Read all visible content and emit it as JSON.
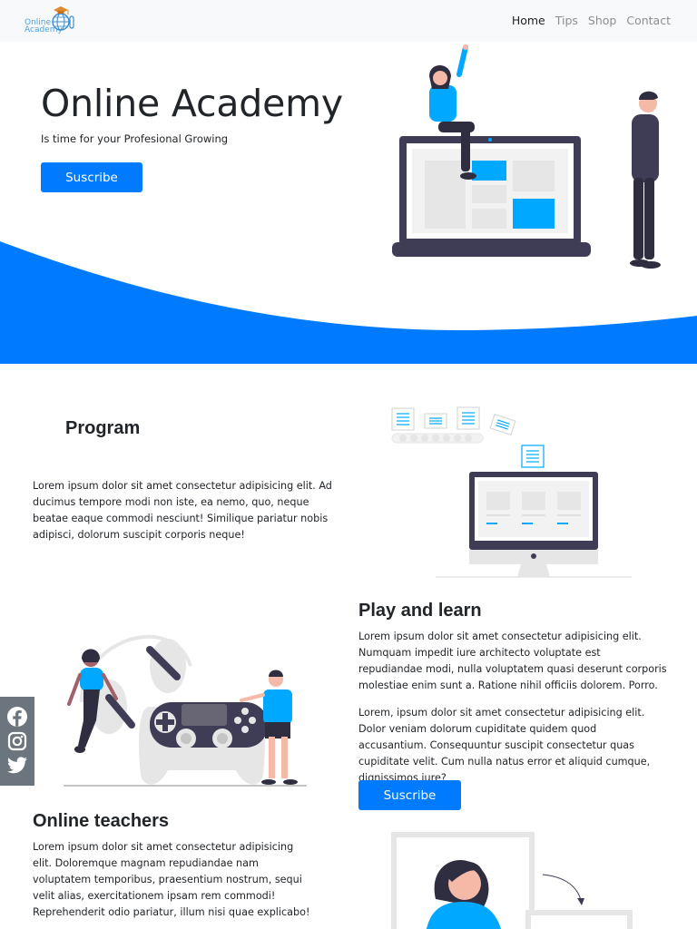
{
  "navbar": {
    "brand": {
      "line1": "Online",
      "line2": "Academy"
    },
    "links": [
      {
        "label": "Home",
        "active": true
      },
      {
        "label": "Tips",
        "active": false
      },
      {
        "label": "Shop",
        "active": false
      },
      {
        "label": "Contact",
        "active": false
      }
    ]
  },
  "hero": {
    "title": "Online Academy",
    "subtitle": "Is time for your Profesional Growing",
    "button_label": "Suscribe"
  },
  "program": {
    "title": "Program",
    "text": "Lorem ipsum dolor sit amet consectetur adipisicing elit. Ad ducimus tempore modi non iste, ea nemo, quo, neque beatae eaque commodi nesciunt! Similique pariatur nobis adipisci, dolorum suscipit corporis neque!"
  },
  "play": {
    "title": "Play and learn",
    "paragraph1": "Lorem ipsum dolor sit amet consectetur adipisicing elit. Numquam impedit iure architecto voluptate est repudiandae modi, nulla voluptatem quasi deserunt corporis molestiae enim sunt a. Ratione nihil officiis dolorem. Porro.",
    "paragraph2": "Lorem, ipsum dolor sit amet consectetur adipisicing elit. Dolor veniam dolorum cupiditate quidem quod accusantium. Consequuntur suscipit consectetur quas cupiditate velit. Cum nulla natus error et aliquid cumque, dignissimos iure?",
    "button_label": "Suscribe"
  },
  "teachers": {
    "title": "Online teachers",
    "text": "Lorem ipsum dolor sit amet consectetur adipisicing elit. Doloremque magnam repudiandae nam voluptatem temporibus, praesentium nostrum, sequi velit alias, exercitationem ipsam rem commodi! Reprehenderit odio pariatur, illum nisi quae explicabo!"
  },
  "social": {
    "icons": [
      "facebook-icon",
      "instagram-icon",
      "twitter-icon"
    ]
  },
  "colors": {
    "accent": "#007bff",
    "illustration_blue": "#00a8ff",
    "navbar_bg": "#f8f9fa",
    "social_bg": "#6c757d",
    "dark": "#3f3d56"
  }
}
